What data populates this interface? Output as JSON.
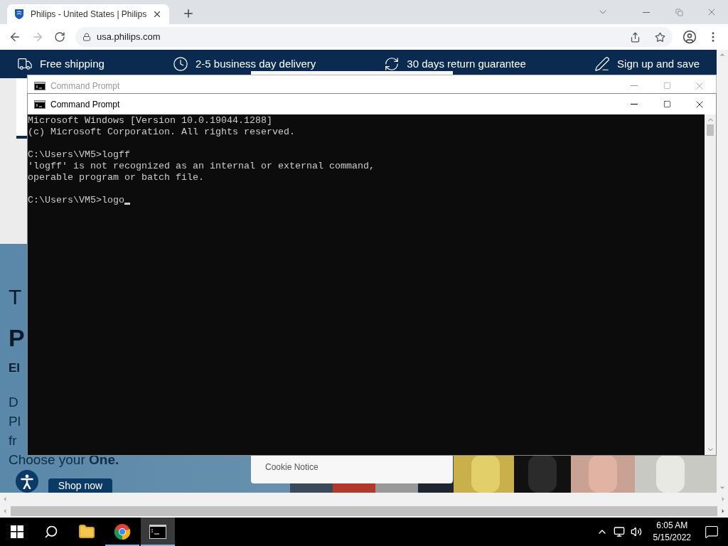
{
  "browser": {
    "tab": {
      "title": "Philips - United States | Philips",
      "selected": true
    },
    "address": "usa.philips.com"
  },
  "page": {
    "benefits": [
      {
        "kind": "truck",
        "label": "Free shipping"
      },
      {
        "kind": "clock",
        "label": "2-5 business day delivery"
      },
      {
        "kind": "return",
        "label": "30 days return guarantee"
      },
      {
        "kind": "signup",
        "label": "Sign up and save"
      }
    ],
    "hero_lines": [
      {
        "kind": "light",
        "text": "T"
      },
      {
        "kind": "big",
        "text": "P"
      },
      {
        "kind": "bold",
        "text": "El"
      },
      {
        "kind": "lead",
        "text": "D"
      },
      {
        "kind": "body",
        "text": "Pl"
      },
      {
        "kind": "body",
        "text": "fr"
      },
      {
        "kind": "body",
        "text": "Choose your **One.**"
      }
    ],
    "shop_button": "Shop now",
    "cookie_notice": "Cookie Notice"
  },
  "windows": [
    {
      "title": "Command Prompt",
      "active": false
    },
    {
      "title": "Command Prompt",
      "active": true,
      "blocks": [
        [
          "Microsoft Windows [Version 10.0.19044.1288]",
          "(c) Microsoft Corporation. All rights reserved."
        ],
        [
          "C:\\Users\\VM5>logff",
          "'logff' is not recognized as an internal or external command,",
          "operable program or batch file."
        ],
        [
          "C:\\Users\\VM5>logo"
        ]
      ]
    }
  ],
  "taskbar": {
    "apps": [
      {
        "kind": "explorer",
        "running": false,
        "selected": false
      },
      {
        "kind": "chrome",
        "running": true,
        "selected": false
      },
      {
        "kind": "terminal",
        "running": true,
        "selected": true
      }
    ],
    "time": "6:05 AM",
    "date": "5/15/2022"
  }
}
